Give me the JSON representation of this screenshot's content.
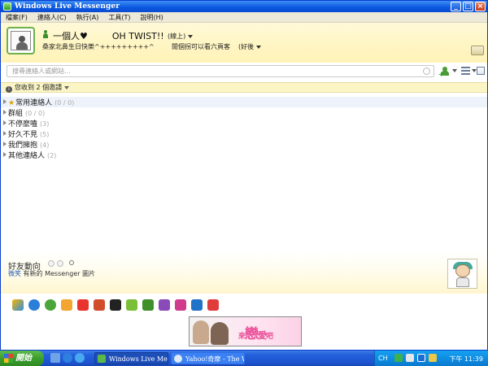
{
  "window": {
    "title": "Windows Live Messenger"
  },
  "menu": [
    "檔案(F)",
    "連絡人(C)",
    "執行(A)",
    "工具(T)",
    "說明(H)"
  ],
  "profile": {
    "nickname": "一個人♥",
    "nickname2": "OH TWIST!!",
    "status": "(線上)",
    "personal_message": "桑家北鼻生日快樂^+++++++++^",
    "now_playing": "閒個拐可以看六頁客",
    "now_playing2": "(好後"
  },
  "search": {
    "placeholder": "搜尋連絡人或網站..."
  },
  "notice": {
    "text": "您收到 2 個邀請"
  },
  "groups": [
    {
      "name": "常用連絡人",
      "count": "(0 / 0)",
      "star": true
    },
    {
      "name": "群組",
      "count": "(0 / 0)",
      "star": false
    },
    {
      "name": "不停麼嗑",
      "count": "(3)",
      "star": false
    },
    {
      "name": "好久不見",
      "count": "(5)",
      "star": false
    },
    {
      "name": "我們擁抱",
      "count": "(4)",
      "star": false
    },
    {
      "name": "其他連絡人",
      "count": "(2)",
      "star": false
    }
  ],
  "feed": {
    "title": "好友動向",
    "who": "微笑",
    "text": "有新的 Messenger 圖片"
  },
  "ad": {
    "text_a": "來",
    "text_b": "戀",
    "text_c": "愛",
    "text_d": "吧"
  },
  "taskbar": {
    "start": "開始",
    "tasks": [
      "Windows Live Messen...",
      "Yahoo!奇摩 - The Wo..."
    ],
    "lang": "CH",
    "time": "下午 11:39"
  },
  "colors": {
    "accent": "#0b56df",
    "header_bg": "#fff5c2",
    "taskbar": "#245edb"
  }
}
